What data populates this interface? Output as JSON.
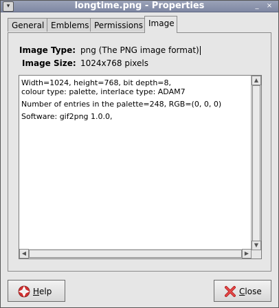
{
  "window": {
    "title": "longtime.png - Properties"
  },
  "titlebar_buttons": {
    "minimize": "_",
    "close": "×"
  },
  "tabs": [
    {
      "label": "General"
    },
    {
      "label": "Emblems"
    },
    {
      "label": "Permissions"
    },
    {
      "label": "Image",
      "active": true
    }
  ],
  "image_info": {
    "type_label": "Image Type:",
    "type_value": "png (The PNG image format)",
    "size_label": "Image Size:",
    "size_value": "1024x768 pixels"
  },
  "details": {
    "line1": "Width=1024, height=768, bit depth=8,\ncolour type: palette, interlace type: ADAM7",
    "line2": "Number of entries in the palette=248, RGB=(0, 0, 0)",
    "line3": "Software: gif2png 1.0.0,"
  },
  "buttons": {
    "help_mnemonic": "H",
    "help_rest": "elp",
    "close_mnemonic": "C",
    "close_rest": "lose"
  }
}
